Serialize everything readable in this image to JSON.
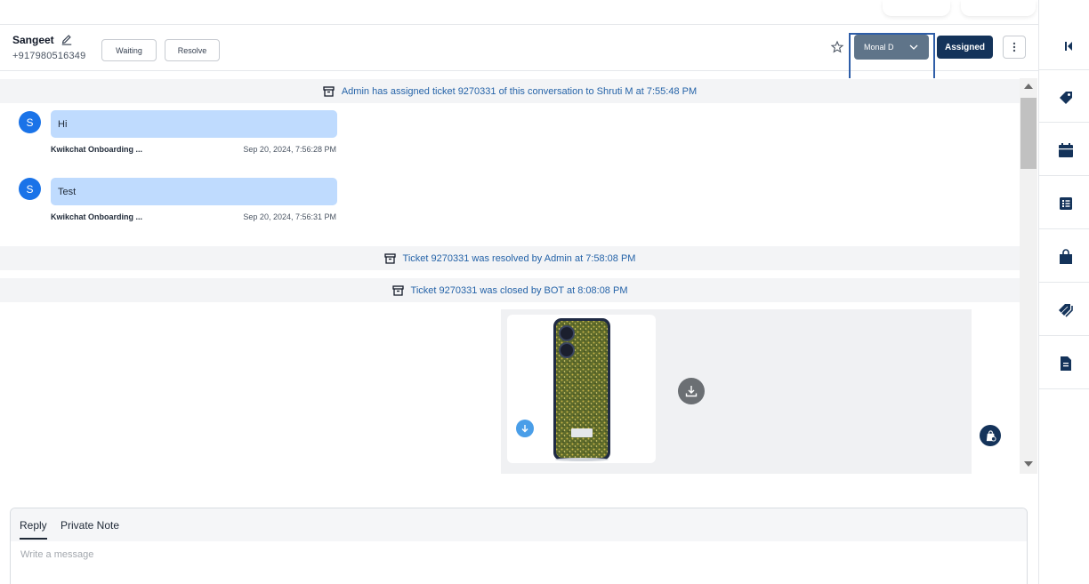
{
  "header": {
    "contact_name": "Sangeet",
    "contact_phone": "+917980516349",
    "waiting_label": "Waiting",
    "resolve_label": "Resolve",
    "agent_selected": "Monal D",
    "status_label": "Assigned"
  },
  "conversation": {
    "events": [
      "Admin has assigned ticket 9270331 of this conversation to Shruti M at 7:55:48 PM",
      "Ticket 9270331 was resolved by Admin at 7:58:08 PM",
      "Ticket 9270331 was closed by BOT at 8:08:08 PM"
    ],
    "messages": [
      {
        "avatar": "S",
        "text": "Hi",
        "sender": "Kwikchat Onboarding ...",
        "time": "Sep 20, 2024, 7:56:28 PM"
      },
      {
        "avatar": "S",
        "text": "Test",
        "sender": "Kwikchat Onboarding ...",
        "time": "Sep 20, 2024, 7:56:31 PM"
      }
    ]
  },
  "composer": {
    "tabs": [
      "Reply",
      "Private Note"
    ],
    "placeholder": "Write a message"
  },
  "colors": {
    "agent_select_bg": "#5f7489",
    "assigned_bg": "#14335a",
    "bubble_bg": "#bfdbfe",
    "event_text": "#2563a8",
    "highlight_border": "#2f5ea8"
  },
  "icons": {
    "header": [
      "edit-icon",
      "star-icon",
      "chevron-down-icon",
      "kebab-menu-icon"
    ],
    "rail": [
      "collapse-icon",
      "tag-icon",
      "calendar-icon",
      "list-icon",
      "shopping-bag-icon",
      "tags-icon",
      "document-icon"
    ]
  }
}
